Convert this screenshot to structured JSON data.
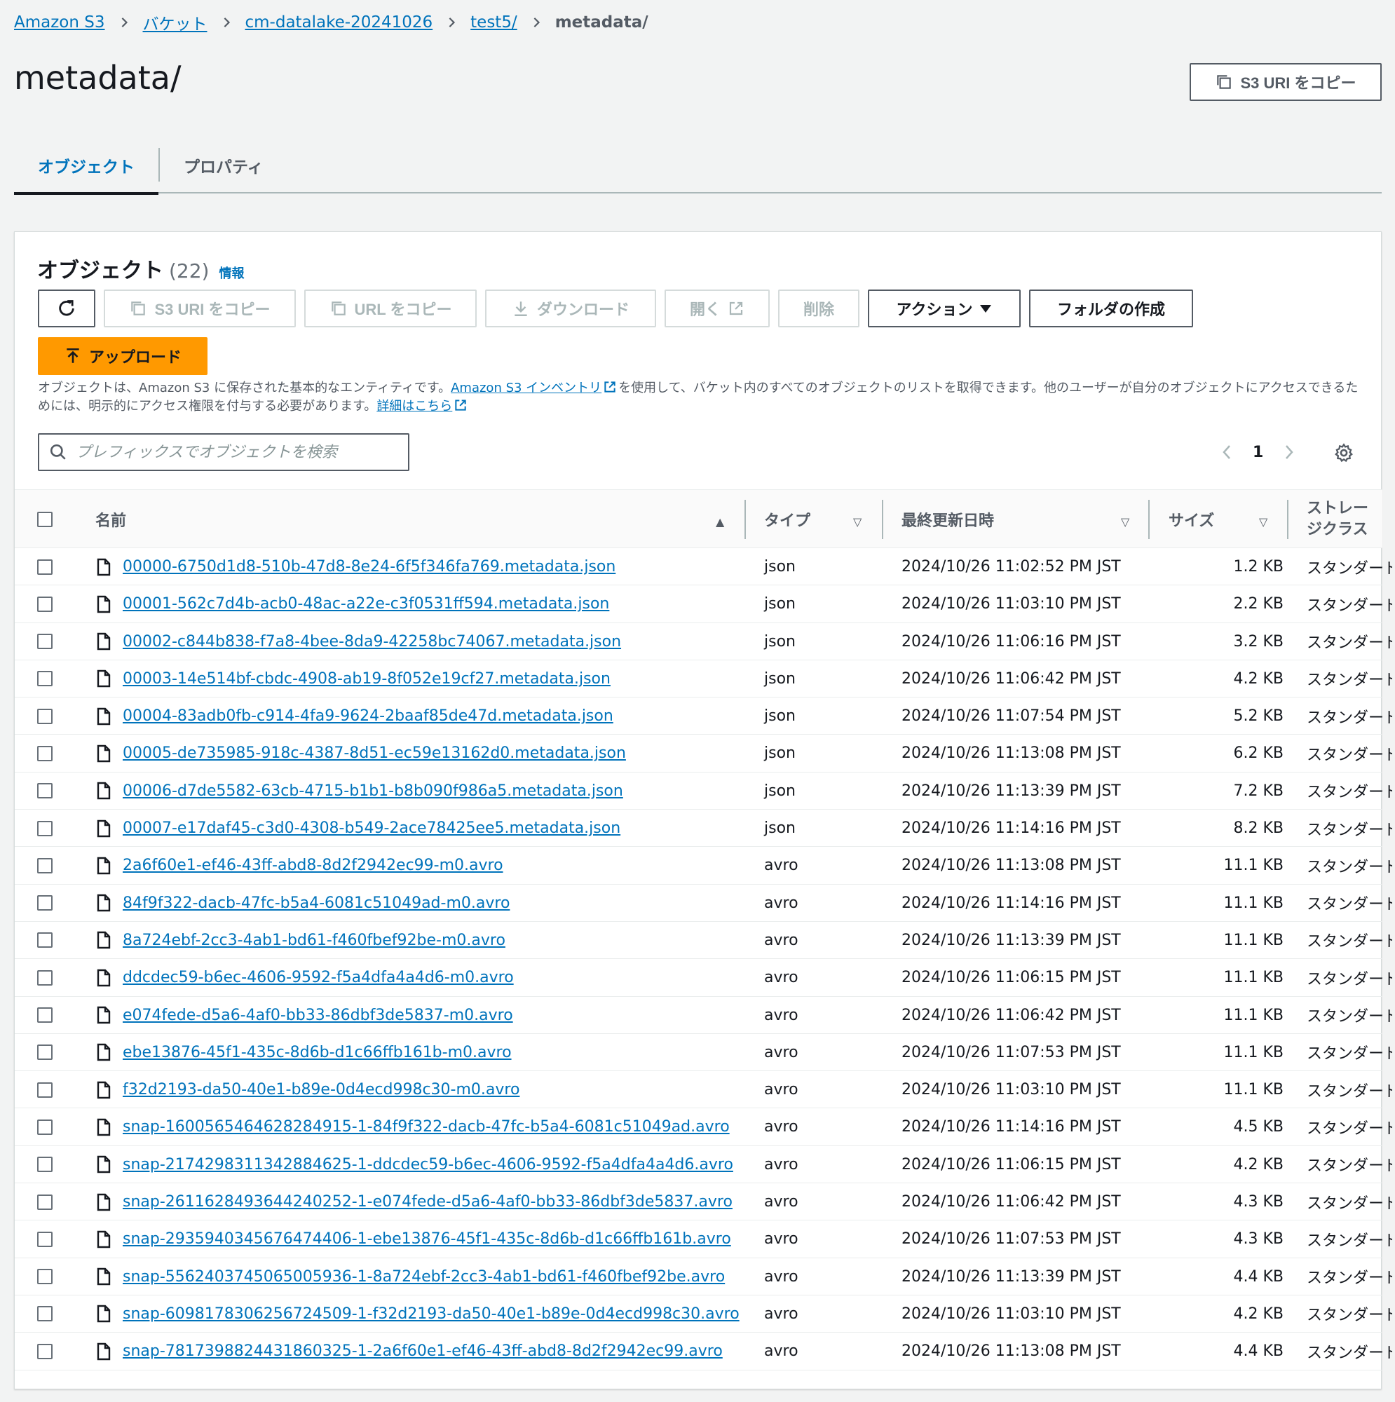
{
  "breadcrumb": {
    "items": [
      "Amazon S3",
      "バケット",
      "cm-datalake-20241026",
      "test5/"
    ],
    "current": "metadata/"
  },
  "page": {
    "title": "metadata/",
    "copy_uri_label": "S3 URI をコピー"
  },
  "tabs": [
    {
      "label": "オブジェクト",
      "active": true
    },
    {
      "label": "プロパティ",
      "active": false
    }
  ],
  "objects_panel": {
    "title": "オブジェクト",
    "count": "(22)",
    "info_label": "情報",
    "toolbar": {
      "copy_s3_uri": "S3 URI をコピー",
      "copy_url": "URL をコピー",
      "download": "ダウンロード",
      "open": "開く",
      "delete": "削除",
      "actions": "アクション",
      "create_folder": "フォルダの作成",
      "upload": "アップロード"
    },
    "description": {
      "text1": "オブジェクトは、Amazon S3 に保存された基本的なエンティティです。",
      "link1": "Amazon S3 インベントリ",
      "text2": "を使用して、バケット内のすべてのオブジェクトのリストを取得できます。他のユーザーが自分のオブジェクトにアクセスできるためには、明示的にアクセス権限を付与する必要があります。",
      "link2": "詳細はこちら"
    },
    "search_placeholder": "プレフィックスでオブジェクトを検索",
    "page_number": "1"
  },
  "table": {
    "columns": {
      "name": "名前",
      "type": "タイプ",
      "modified": "最終更新日時",
      "size": "サイズ",
      "storage_line1": "ストレー",
      "storage_line2": "ジクラス"
    },
    "rows": [
      {
        "name": "00000-6750d1d8-510b-47d8-8e24-6f5f346fa769.metadata.json",
        "type": "json",
        "modified": "2024/10/26 11:02:52 PM JST",
        "size": "1.2 KB",
        "storage": "スタンダード"
      },
      {
        "name": "00001-562c7d4b-acb0-48ac-a22e-c3f0531ff594.metadata.json",
        "type": "json",
        "modified": "2024/10/26 11:03:10 PM JST",
        "size": "2.2 KB",
        "storage": "スタンダード"
      },
      {
        "name": "00002-c844b838-f7a8-4bee-8da9-42258bc74067.metadata.json",
        "type": "json",
        "modified": "2024/10/26 11:06:16 PM JST",
        "size": "3.2 KB",
        "storage": "スタンダード"
      },
      {
        "name": "00003-14e514bf-cbdc-4908-ab19-8f052e19cf27.metadata.json",
        "type": "json",
        "modified": "2024/10/26 11:06:42 PM JST",
        "size": "4.2 KB",
        "storage": "スタンダード"
      },
      {
        "name": "00004-83adb0fb-c914-4fa9-9624-2baaf85de47d.metadata.json",
        "type": "json",
        "modified": "2024/10/26 11:07:54 PM JST",
        "size": "5.2 KB",
        "storage": "スタンダード"
      },
      {
        "name": "00005-de735985-918c-4387-8d51-ec59e13162d0.metadata.json",
        "type": "json",
        "modified": "2024/10/26 11:13:08 PM JST",
        "size": "6.2 KB",
        "storage": "スタンダード"
      },
      {
        "name": "00006-d7de5582-63cb-4715-b1b1-b8b090f986a5.metadata.json",
        "type": "json",
        "modified": "2024/10/26 11:13:39 PM JST",
        "size": "7.2 KB",
        "storage": "スタンダード"
      },
      {
        "name": "00007-e17daf45-c3d0-4308-b549-2ace78425ee5.metadata.json",
        "type": "json",
        "modified": "2024/10/26 11:14:16 PM JST",
        "size": "8.2 KB",
        "storage": "スタンダード"
      },
      {
        "name": "2a6f60e1-ef46-43ff-abd8-8d2f2942ec99-m0.avro",
        "type": "avro",
        "modified": "2024/10/26 11:13:08 PM JST",
        "size": "11.1 KB",
        "storage": "スタンダード"
      },
      {
        "name": "84f9f322-dacb-47fc-b5a4-6081c51049ad-m0.avro",
        "type": "avro",
        "modified": "2024/10/26 11:14:16 PM JST",
        "size": "11.1 KB",
        "storage": "スタンダード"
      },
      {
        "name": "8a724ebf-2cc3-4ab1-bd61-f460fbef92be-m0.avro",
        "type": "avro",
        "modified": "2024/10/26 11:13:39 PM JST",
        "size": "11.1 KB",
        "storage": "スタンダード"
      },
      {
        "name": "ddcdec59-b6ec-4606-9592-f5a4dfa4a4d6-m0.avro",
        "type": "avro",
        "modified": "2024/10/26 11:06:15 PM JST",
        "size": "11.1 KB",
        "storage": "スタンダード"
      },
      {
        "name": "e074fede-d5a6-4af0-bb33-86dbf3de5837-m0.avro",
        "type": "avro",
        "modified": "2024/10/26 11:06:42 PM JST",
        "size": "11.1 KB",
        "storage": "スタンダード"
      },
      {
        "name": "ebe13876-45f1-435c-8d6b-d1c66ffb161b-m0.avro",
        "type": "avro",
        "modified": "2024/10/26 11:07:53 PM JST",
        "size": "11.1 KB",
        "storage": "スタンダード"
      },
      {
        "name": "f32d2193-da50-40e1-b89e-0d4ecd998c30-m0.avro",
        "type": "avro",
        "modified": "2024/10/26 11:03:10 PM JST",
        "size": "11.1 KB",
        "storage": "スタンダード"
      },
      {
        "name": "snap-1600565464628284915-1-84f9f322-dacb-47fc-b5a4-6081c51049ad.avro",
        "type": "avro",
        "modified": "2024/10/26 11:14:16 PM JST",
        "size": "4.5 KB",
        "storage": "スタンダード"
      },
      {
        "name": "snap-2174298311342884625-1-ddcdec59-b6ec-4606-9592-f5a4dfa4a4d6.avro",
        "type": "avro",
        "modified": "2024/10/26 11:06:15 PM JST",
        "size": "4.2 KB",
        "storage": "スタンダード"
      },
      {
        "name": "snap-2611628493644240252-1-e074fede-d5a6-4af0-bb33-86dbf3de5837.avro",
        "type": "avro",
        "modified": "2024/10/26 11:06:42 PM JST",
        "size": "4.3 KB",
        "storage": "スタンダード"
      },
      {
        "name": "snap-2935940345676474406-1-ebe13876-45f1-435c-8d6b-d1c66ffb161b.avro",
        "type": "avro",
        "modified": "2024/10/26 11:07:53 PM JST",
        "size": "4.3 KB",
        "storage": "スタンダード"
      },
      {
        "name": "snap-5562403745065005936-1-8a724ebf-2cc3-4ab1-bd61-f460fbef92be.avro",
        "type": "avro",
        "modified": "2024/10/26 11:13:39 PM JST",
        "size": "4.4 KB",
        "storage": "スタンダード"
      },
      {
        "name": "snap-6098178306256724509-1-f32d2193-da50-40e1-b89e-0d4ecd998c30.avro",
        "type": "avro",
        "modified": "2024/10/26 11:03:10 PM JST",
        "size": "4.2 KB",
        "storage": "スタンダード"
      },
      {
        "name": "snap-7817398824431860325-1-2a6f60e1-ef46-43ff-abd8-8d2f2942ec99.avro",
        "type": "avro",
        "modified": "2024/10/26 11:13:08 PM JST",
        "size": "4.4 KB",
        "storage": "スタンダード"
      }
    ]
  },
  "colors": {
    "link": "#0073bb",
    "upload_button": "#ff9900",
    "background": "#f2f3f3"
  }
}
